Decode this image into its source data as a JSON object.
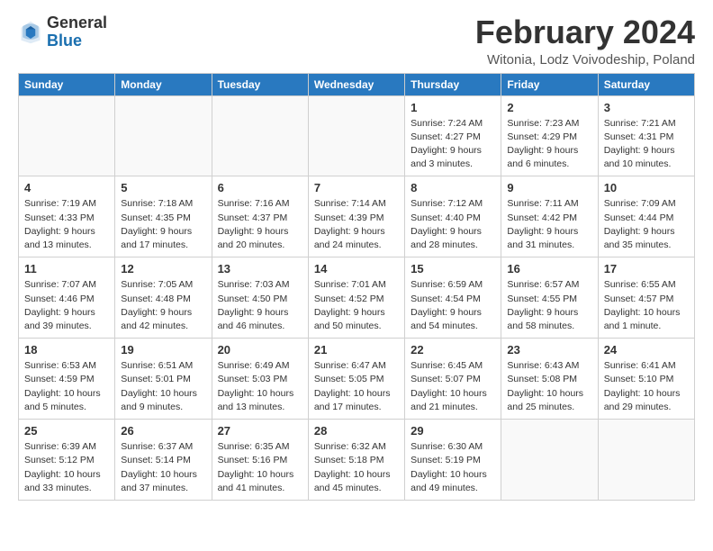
{
  "logo": {
    "general": "General",
    "blue": "Blue"
  },
  "title": "February 2024",
  "location": "Witonia, Lodz Voivodeship, Poland",
  "headers": [
    "Sunday",
    "Monday",
    "Tuesday",
    "Wednesday",
    "Thursday",
    "Friday",
    "Saturday"
  ],
  "weeks": [
    [
      {
        "day": "",
        "info": ""
      },
      {
        "day": "",
        "info": ""
      },
      {
        "day": "",
        "info": ""
      },
      {
        "day": "",
        "info": ""
      },
      {
        "day": "1",
        "info": "Sunrise: 7:24 AM\nSunset: 4:27 PM\nDaylight: 9 hours\nand 3 minutes."
      },
      {
        "day": "2",
        "info": "Sunrise: 7:23 AM\nSunset: 4:29 PM\nDaylight: 9 hours\nand 6 minutes."
      },
      {
        "day": "3",
        "info": "Sunrise: 7:21 AM\nSunset: 4:31 PM\nDaylight: 9 hours\nand 10 minutes."
      }
    ],
    [
      {
        "day": "4",
        "info": "Sunrise: 7:19 AM\nSunset: 4:33 PM\nDaylight: 9 hours\nand 13 minutes."
      },
      {
        "day": "5",
        "info": "Sunrise: 7:18 AM\nSunset: 4:35 PM\nDaylight: 9 hours\nand 17 minutes."
      },
      {
        "day": "6",
        "info": "Sunrise: 7:16 AM\nSunset: 4:37 PM\nDaylight: 9 hours\nand 20 minutes."
      },
      {
        "day": "7",
        "info": "Sunrise: 7:14 AM\nSunset: 4:39 PM\nDaylight: 9 hours\nand 24 minutes."
      },
      {
        "day": "8",
        "info": "Sunrise: 7:12 AM\nSunset: 4:40 PM\nDaylight: 9 hours\nand 28 minutes."
      },
      {
        "day": "9",
        "info": "Sunrise: 7:11 AM\nSunset: 4:42 PM\nDaylight: 9 hours\nand 31 minutes."
      },
      {
        "day": "10",
        "info": "Sunrise: 7:09 AM\nSunset: 4:44 PM\nDaylight: 9 hours\nand 35 minutes."
      }
    ],
    [
      {
        "day": "11",
        "info": "Sunrise: 7:07 AM\nSunset: 4:46 PM\nDaylight: 9 hours\nand 39 minutes."
      },
      {
        "day": "12",
        "info": "Sunrise: 7:05 AM\nSunset: 4:48 PM\nDaylight: 9 hours\nand 42 minutes."
      },
      {
        "day": "13",
        "info": "Sunrise: 7:03 AM\nSunset: 4:50 PM\nDaylight: 9 hours\nand 46 minutes."
      },
      {
        "day": "14",
        "info": "Sunrise: 7:01 AM\nSunset: 4:52 PM\nDaylight: 9 hours\nand 50 minutes."
      },
      {
        "day": "15",
        "info": "Sunrise: 6:59 AM\nSunset: 4:54 PM\nDaylight: 9 hours\nand 54 minutes."
      },
      {
        "day": "16",
        "info": "Sunrise: 6:57 AM\nSunset: 4:55 PM\nDaylight: 9 hours\nand 58 minutes."
      },
      {
        "day": "17",
        "info": "Sunrise: 6:55 AM\nSunset: 4:57 PM\nDaylight: 10 hours\nand 1 minute."
      }
    ],
    [
      {
        "day": "18",
        "info": "Sunrise: 6:53 AM\nSunset: 4:59 PM\nDaylight: 10 hours\nand 5 minutes."
      },
      {
        "day": "19",
        "info": "Sunrise: 6:51 AM\nSunset: 5:01 PM\nDaylight: 10 hours\nand 9 minutes."
      },
      {
        "day": "20",
        "info": "Sunrise: 6:49 AM\nSunset: 5:03 PM\nDaylight: 10 hours\nand 13 minutes."
      },
      {
        "day": "21",
        "info": "Sunrise: 6:47 AM\nSunset: 5:05 PM\nDaylight: 10 hours\nand 17 minutes."
      },
      {
        "day": "22",
        "info": "Sunrise: 6:45 AM\nSunset: 5:07 PM\nDaylight: 10 hours\nand 21 minutes."
      },
      {
        "day": "23",
        "info": "Sunrise: 6:43 AM\nSunset: 5:08 PM\nDaylight: 10 hours\nand 25 minutes."
      },
      {
        "day": "24",
        "info": "Sunrise: 6:41 AM\nSunset: 5:10 PM\nDaylight: 10 hours\nand 29 minutes."
      }
    ],
    [
      {
        "day": "25",
        "info": "Sunrise: 6:39 AM\nSunset: 5:12 PM\nDaylight: 10 hours\nand 33 minutes."
      },
      {
        "day": "26",
        "info": "Sunrise: 6:37 AM\nSunset: 5:14 PM\nDaylight: 10 hours\nand 37 minutes."
      },
      {
        "day": "27",
        "info": "Sunrise: 6:35 AM\nSunset: 5:16 PM\nDaylight: 10 hours\nand 41 minutes."
      },
      {
        "day": "28",
        "info": "Sunrise: 6:32 AM\nSunset: 5:18 PM\nDaylight: 10 hours\nand 45 minutes."
      },
      {
        "day": "29",
        "info": "Sunrise: 6:30 AM\nSunset: 5:19 PM\nDaylight: 10 hours\nand 49 minutes."
      },
      {
        "day": "",
        "info": ""
      },
      {
        "day": "",
        "info": ""
      }
    ]
  ]
}
